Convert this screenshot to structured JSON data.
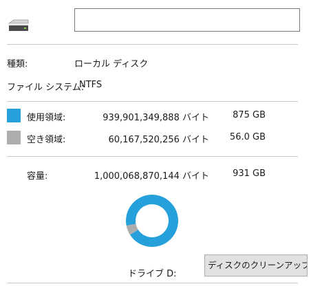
{
  "header": {
    "drive_icon": "hard-drive-icon",
    "name_value": ""
  },
  "general": {
    "type_label": "種類:",
    "type_value": "ローカル ディスク",
    "fs_label": "ファイル システム:",
    "fs_value": "NTFS"
  },
  "usage": {
    "used": {
      "label": "使用領域:",
      "bytes": "939,901,349,888 バイト",
      "size": "875 GB",
      "color": "#26a0da"
    },
    "free": {
      "label": "空き領域:",
      "bytes": "60,167,520,256 バイト",
      "size": "56.0 GB",
      "color": "#adadad"
    },
    "capacity": {
      "label": "容量:",
      "bytes": "1,000,068,870,144 バイト",
      "size": "931 GB"
    }
  },
  "chart_data": {
    "type": "pie",
    "categories": [
      "使用領域",
      "空き領域"
    ],
    "values": [
      939901349888,
      60167520256
    ],
    "colors": [
      "#26a0da",
      "#adadad"
    ],
    "donut": true
  },
  "drive": {
    "label": "ドライブ D:"
  },
  "buttons": {
    "cleanup_label": "ディスクのクリーンアップ(D)"
  }
}
